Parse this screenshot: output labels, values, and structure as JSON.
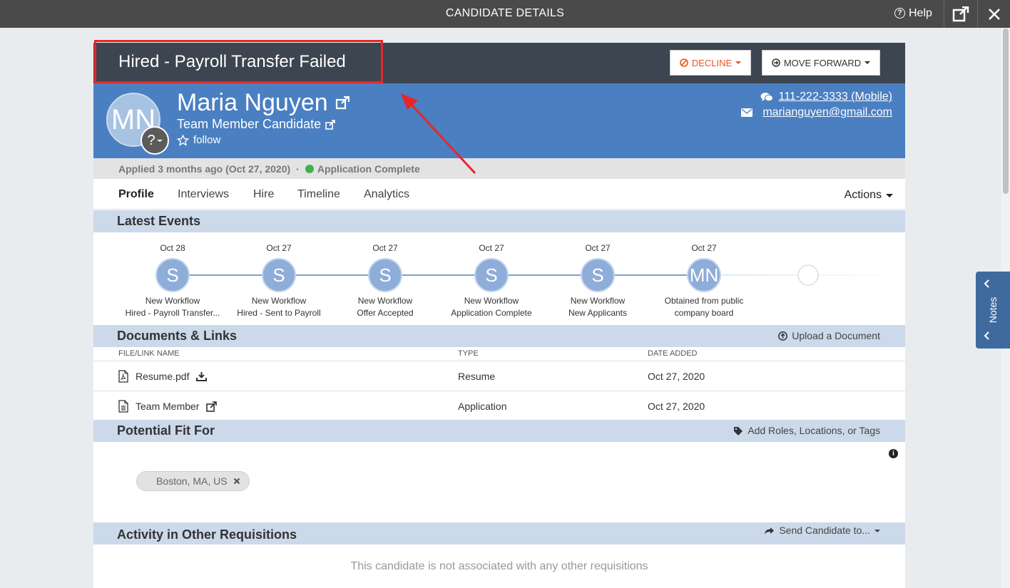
{
  "topbar": {
    "title": "CANDIDATE DETAILS",
    "help": "Help"
  },
  "header": {
    "status": "Hired - Payroll Transfer Failed",
    "decline": "DECLINE",
    "move_forward": "MOVE FORWARD"
  },
  "candidate": {
    "initials": "MN",
    "name": "Maria Nguyen",
    "role": "Team Member Candidate",
    "follow": "follow",
    "phone": "111-222-3333 (Mobile)",
    "email": "marianguyen@gmail.com",
    "avatar_badge": "?"
  },
  "applied": {
    "text": "Applied 3 months ago (Oct 27, 2020)",
    "sep": "·",
    "status": "Application Complete"
  },
  "tabs": [
    "Profile",
    "Interviews",
    "Hire",
    "Timeline",
    "Analytics"
  ],
  "actions": "Actions",
  "latest_events": {
    "title": "Latest Events",
    "events": [
      {
        "date": "Oct 28",
        "initial": "S",
        "line1": "New Workflow",
        "line2": "Hired - Payroll Transfer..."
      },
      {
        "date": "Oct 27",
        "initial": "S",
        "line1": "New Workflow",
        "line2": "Hired - Sent to Payroll"
      },
      {
        "date": "Oct 27",
        "initial": "S",
        "line1": "New Workflow",
        "line2": "Offer Accepted"
      },
      {
        "date": "Oct 27",
        "initial": "S",
        "line1": "New Workflow",
        "line2": "Application Complete"
      },
      {
        "date": "Oct 27",
        "initial": "S",
        "line1": "New Workflow",
        "line2": "New Applicants"
      },
      {
        "date": "Oct 27",
        "initial": "MN",
        "line1": "Obtained from public",
        "line2": "company board"
      }
    ]
  },
  "documents": {
    "title": "Documents & Links",
    "upload": "Upload a Document",
    "columns": [
      "FILE/LINK NAME",
      "TYPE",
      "DATE ADDED"
    ],
    "rows": [
      {
        "name": "Resume.pdf",
        "type": "Resume",
        "date": "Oct 27, 2020"
      },
      {
        "name": "Team Member",
        "type": "Application",
        "date": "Oct 27, 2020"
      }
    ]
  },
  "potential_fit": {
    "title": "Potential Fit For",
    "action": "Add Roles, Locations, or Tags",
    "tags": [
      "Boston, MA, US"
    ]
  },
  "other_reqs": {
    "title": "Activity in Other Requisitions",
    "action": "Send Candidate to...",
    "empty": "This candidate is not associated with any other requisitions"
  },
  "notes": "Notes",
  "colors": {
    "topbar": "#4a4a4a",
    "header": "#3c4550",
    "profile": "#4a7fc1",
    "section": "#ccd9ea",
    "decline": "#e8561e",
    "annotation": "#e8262a",
    "status_dot": "#3fb24f"
  }
}
